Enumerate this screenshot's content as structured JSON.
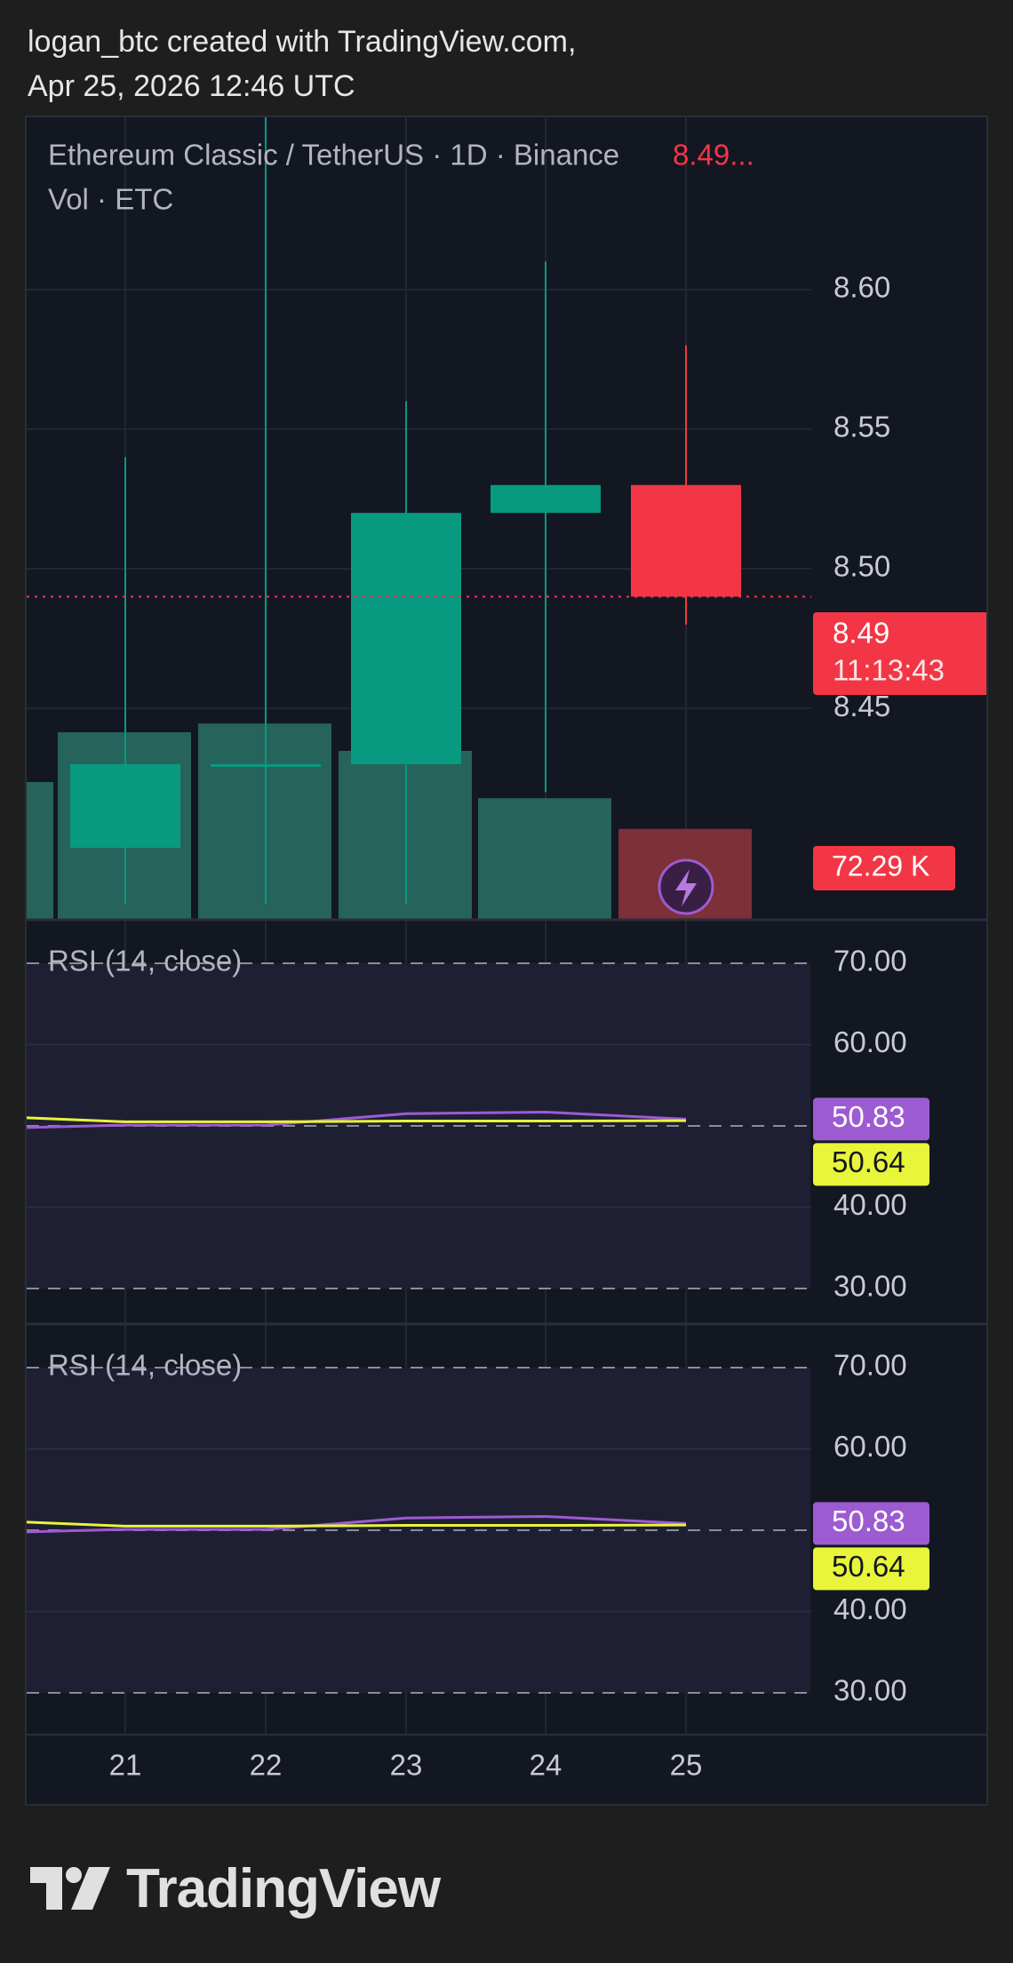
{
  "header": {
    "line1": "logan_btc created with TradingView.com,",
    "line2": "Apr 25, 2026 12:46 UTC"
  },
  "footer": {
    "brand": "TradingView"
  },
  "colors": {
    "up": "#089981",
    "down": "#f23645",
    "vol_up": "#26635a",
    "vol_down": "#7c3038",
    "rsi_purple": "#9d5bd2",
    "rsi_yellow": "#e8f53a"
  },
  "chart_data": [
    {
      "type": "candlestick",
      "legend_title": "Ethereum Classic / TetherUS · 1D · Binance",
      "legend_price": "8.49...",
      "volume_label": "Vol · ETC",
      "x": [
        "20",
        "21",
        "22",
        "23",
        "24",
        "25"
      ],
      "x_tick_labels": [
        "21",
        "22",
        "23",
        "24",
        "25"
      ],
      "ohlc": [
        {
          "x": "21",
          "open": 8.4,
          "high": 8.54,
          "low": 8.38,
          "close": 8.43
        },
        {
          "x": "22",
          "open": 8.43,
          "high": 8.67,
          "low": 8.38,
          "close": 8.43
        },
        {
          "x": "23",
          "open": 8.43,
          "high": 8.56,
          "low": 8.38,
          "close": 8.52
        },
        {
          "x": "24",
          "open": 8.52,
          "high": 8.61,
          "low": 8.42,
          "close": 8.53
        },
        {
          "x": "25",
          "open": 8.53,
          "high": 8.58,
          "low": 8.48,
          "close": 8.49
        }
      ],
      "volume": [
        {
          "x": "20",
          "value": 110000,
          "dir": "up"
        },
        {
          "x": "21",
          "value": 150000,
          "dir": "up"
        },
        {
          "x": "22",
          "value": 157000,
          "dir": "up"
        },
        {
          "x": "23",
          "value": 135000,
          "dir": "up"
        },
        {
          "x": "24",
          "value": 97000,
          "dir": "up"
        },
        {
          "x": "25",
          "value": 72290,
          "dir": "down"
        }
      ],
      "y_ticks": [
        "8.60",
        "8.55",
        "8.50",
        "8.45"
      ],
      "ylim": [
        8.3746,
        8.6617
      ],
      "last_price": "8.49",
      "countdown": "11:13:43",
      "volume_badge": "72.29 K",
      "grid": true
    },
    {
      "type": "line",
      "title": "RSI (14, close)",
      "x": [
        "20",
        "21",
        "22",
        "23",
        "24",
        "25"
      ],
      "series": [
        {
          "color": "#9d5bd2",
          "values": [
            49.8,
            50.1,
            50.1,
            51.5,
            51.7,
            50.83
          ]
        },
        {
          "color": "#e8f53a",
          "values": [
            51.0,
            50.5,
            50.5,
            50.6,
            50.6,
            50.64
          ]
        }
      ],
      "y_ticks": [
        "70.00",
        "60.00",
        "50.00",
        "40.00",
        "30.00"
      ],
      "ylim": [
        30,
        70
      ],
      "bands": [
        30,
        50,
        70
      ],
      "badges": [
        "50.83",
        "50.64"
      ]
    },
    {
      "type": "line",
      "title": "RSI (14, close)",
      "x": [
        "20",
        "21",
        "22",
        "23",
        "24",
        "25"
      ],
      "series": [
        {
          "color": "#9d5bd2",
          "values": [
            49.8,
            50.1,
            50.1,
            51.5,
            51.7,
            50.83
          ]
        },
        {
          "color": "#e8f53a",
          "values": [
            51.0,
            50.5,
            50.5,
            50.6,
            50.6,
            50.64
          ]
        }
      ],
      "y_ticks": [
        "70.00",
        "60.00",
        "50.00",
        "40.00",
        "30.00"
      ],
      "ylim": [
        30,
        70
      ],
      "bands": [
        30,
        50,
        70
      ],
      "badges": [
        "50.83",
        "50.64"
      ]
    }
  ]
}
